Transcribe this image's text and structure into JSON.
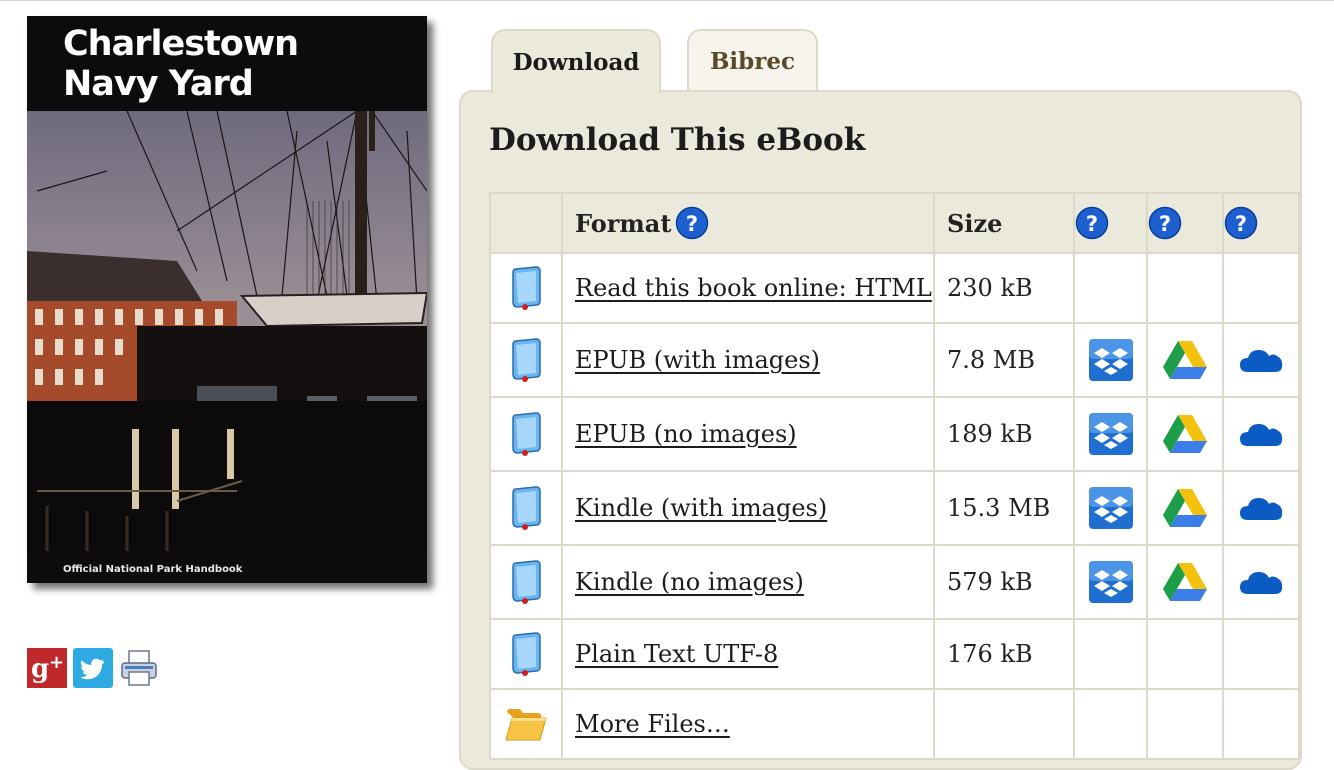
{
  "cover": {
    "title_line1": "Charlestown",
    "title_line2": "Navy Yard",
    "subtitle": "Official National Park Handbook"
  },
  "share": [
    {
      "icon": "google-plus-icon",
      "color": "#c0282c"
    },
    {
      "icon": "twitter-icon",
      "color": "#2fa9e1"
    },
    {
      "icon": "printer-icon",
      "color": "#4a7bc0"
    }
  ],
  "tabs": [
    {
      "label": "Download",
      "active": true
    },
    {
      "label": "Bibrec",
      "active": false
    }
  ],
  "panel": {
    "heading": "Download This eBook"
  },
  "table": {
    "headers": {
      "format": "Format",
      "size": "Size"
    },
    "rows": [
      {
        "format": "Read this book online: HTML",
        "size": "230 kB",
        "icon": "book-icon",
        "services": false
      },
      {
        "format": "EPUB (with images)",
        "size": "7.8 MB",
        "icon": "book-icon",
        "services": true
      },
      {
        "format": "EPUB (no images)",
        "size": "189 kB",
        "icon": "book-icon",
        "services": true
      },
      {
        "format": "Kindle (with images)",
        "size": "15.3 MB",
        "icon": "book-icon",
        "services": true
      },
      {
        "format": "Kindle (no images)",
        "size": "579 kB",
        "icon": "book-icon",
        "services": true
      },
      {
        "format": "Plain Text UTF-8",
        "size": "176 kB",
        "icon": "book-icon",
        "services": false
      },
      {
        "format": "More Files…",
        "size": "",
        "icon": "folder-icon",
        "services": false
      }
    ],
    "services": [
      "dropbox-icon",
      "google-drive-icon",
      "onedrive-icon"
    ]
  },
  "colors": {
    "panel_bg": "#ebe8dc",
    "panel_border": "#ddd9c9",
    "help_blue": "#1e5fd0",
    "bibrec_text": "#5b4a2a"
  }
}
